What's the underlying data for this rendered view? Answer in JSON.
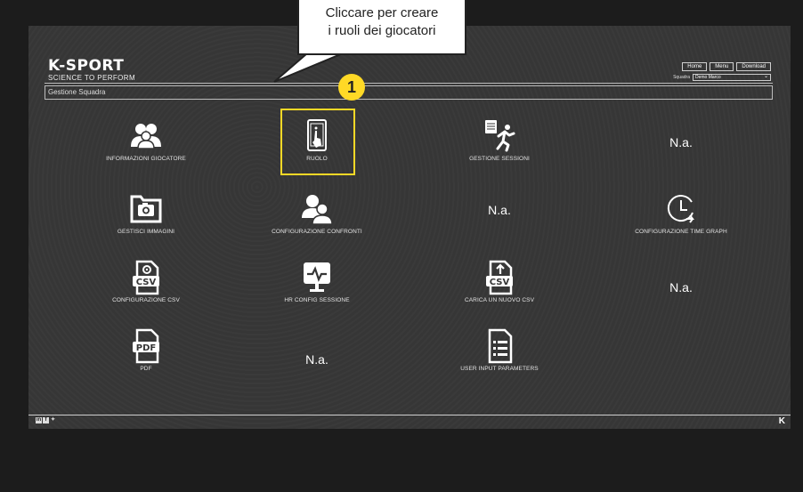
{
  "callout": {
    "line1": "Cliccare per creare",
    "line2": "i ruoli dei giocatori",
    "step": "1"
  },
  "header": {
    "logo": {
      "brand": "K-SPORT",
      "tagline": "SCIENCE TO PERFORM"
    },
    "nav": [
      "Home",
      "Menu",
      "Download"
    ],
    "squadra_label": "Squadra",
    "squadra_value": "Demo Marco",
    "section_title": "Gestione Squadra"
  },
  "tiles": [
    {
      "label": "INFORMAZIONI GIOCATORE",
      "icon": "users-icon"
    },
    {
      "label": "RUOLO",
      "icon": "tablet-touch-icon"
    },
    {
      "label": "GESTIONE SESSIONI",
      "icon": "running-person-icon"
    },
    {
      "label": "GESTISCI IMMAGINI",
      "icon": "folder-camera-icon"
    },
    {
      "label": "CONFIGURAZIONE CONFRONTI",
      "icon": "users-icon"
    },
    {
      "label": "CONFIGURAZIONE TIME GRAPH",
      "icon": "clock-arrow-icon"
    },
    {
      "label": "CONFIGURAZIONE CSV",
      "icon": "csv-gear-icon"
    },
    {
      "label": "HR CONFIG SESSIONE",
      "icon": "heart-monitor-icon"
    },
    {
      "label": "CARICA UN NUOVO CSV",
      "icon": "csv-upload-icon"
    },
    {
      "label": "PDF",
      "icon": "pdf-file-icon"
    },
    {
      "label": "USER INPUT PARAMETERS",
      "icon": "document-list-icon"
    }
  ],
  "na_text": "N.a.",
  "colors": {
    "highlight": "#ffd926",
    "panel": "#363636"
  }
}
